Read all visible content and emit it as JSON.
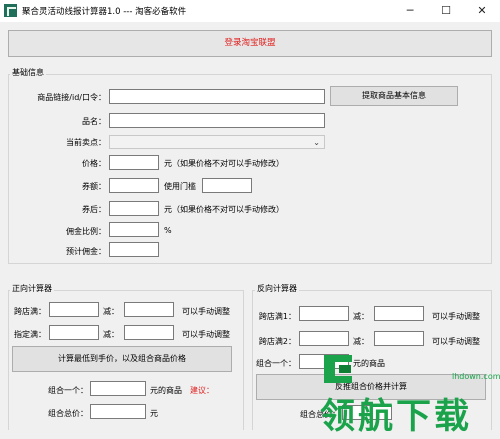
{
  "titlebar": {
    "title": "聚合灵活动线报计算器1.0  ---  淘客必备软件",
    "min": "─",
    "max": "☐",
    "close": "✕"
  },
  "login_button": "登录淘宝联盟",
  "basic": {
    "legend": "基础信息",
    "link_label": "商品链接/id/口令：",
    "link_value": "",
    "fetch_button": "提取商品基本信息",
    "name_label": "品名：",
    "selling_label": "当前卖点：",
    "price_label": "价格：",
    "price_note": "元（如果价格不对可以手动修改）",
    "coupon_label": "券额：",
    "threshold_label": "使用门槛",
    "after_label": "券后：",
    "after_note": "元（如果价格不对可以手动修改）",
    "commission_ratio_label": "佣金比例：",
    "percent": "%",
    "est_commission_label": "预计佣金："
  },
  "forward": {
    "legend": "正向计算器",
    "row1_label": "跨店满：",
    "minus": "减：",
    "adjust": "可以手动调整",
    "row2_label": "指定满：",
    "calc_button": "计算最低到手价，以及组合商品价格",
    "combo_label": "组合一个：",
    "combo_unit": "元的商品",
    "suggest": "建议：",
    "total_label": "组合总价：",
    "total_unit": "元"
  },
  "reverse": {
    "legend": "反向计算器",
    "row1_label": "跨店满1：",
    "minus": "减：",
    "adjust": "可以手动调整",
    "row2_label": "跨店满2：",
    "combo_label": "组合一个：",
    "combo_unit": "元的商品",
    "calc_button": "反推组合价格并计算",
    "total_label": "组合总价："
  },
  "watermark": {
    "text": "领航下载",
    "site": "lhdown.com"
  },
  "colors": {
    "login_text": "#e0201f",
    "suggest_text": "#e0201f",
    "watermark": "#1aa34a"
  }
}
